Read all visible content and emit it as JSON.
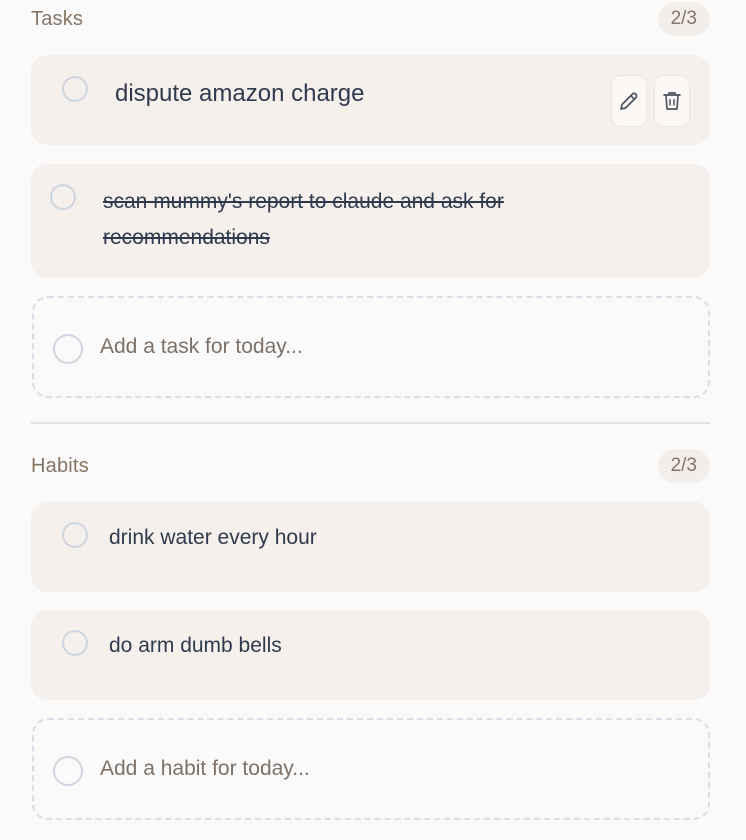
{
  "tasks": {
    "title": "Tasks",
    "count": "2/3",
    "items": [
      {
        "text": "dispute amazon charge",
        "done": false
      },
      {
        "text": "scan mummy's report to claude and ask for recommendations",
        "done": true
      }
    ],
    "add_placeholder": "Add a task for today..."
  },
  "habits": {
    "title": "Habits",
    "count": "2/3",
    "items": [
      {
        "text": "drink water every hour",
        "done": false
      },
      {
        "text": "do arm dumb bells",
        "done": false
      }
    ],
    "add_placeholder": "Add a habit for today..."
  },
  "icons": {
    "edit": "pencil-icon",
    "delete": "trash-icon",
    "checkbox": "circle-checkbox"
  },
  "colors": {
    "card_bg": "#f5f0ec",
    "text": "#2f3a4e",
    "muted": "#857564",
    "checkbox_border": "#cfd6e0"
  }
}
